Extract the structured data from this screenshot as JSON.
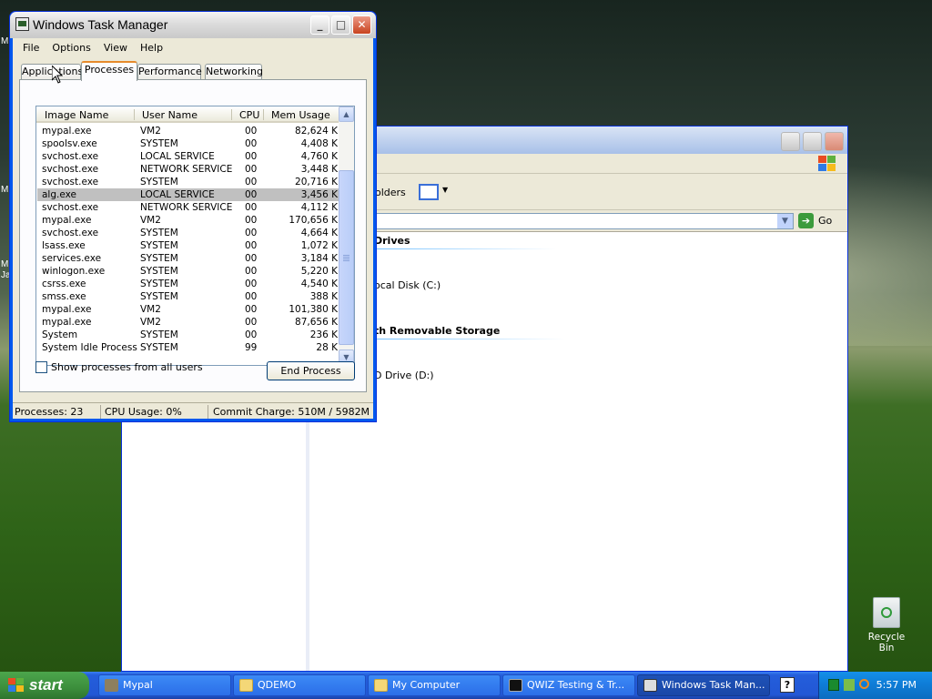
{
  "desktop": {
    "edge_letters": [
      "M",
      "M",
      "M",
      "Ja"
    ],
    "recycle_bin_label": "Recycle Bin"
  },
  "explorer": {
    "toolbar_folders": "olders",
    "go_label": "Go",
    "sections": [
      {
        "title": "Drives",
        "items": [
          "ocal Disk (C:)"
        ]
      },
      {
        "title": "th Removable Storage",
        "items": [
          "D Drive (D:)"
        ]
      }
    ]
  },
  "taskmgr": {
    "title": "Windows Task Manager",
    "menu": [
      "File",
      "Options",
      "View",
      "Help"
    ],
    "tabs": [
      "Applications",
      "Processes",
      "Performance",
      "Networking"
    ],
    "active_tab": "Processes",
    "columns": [
      "Image Name",
      "User Name",
      "CPU",
      "Mem Usage"
    ],
    "rows": [
      {
        "image": "mypal.exe",
        "user": "VM2",
        "cpu": "00",
        "mem": "82,624 K"
      },
      {
        "image": "spoolsv.exe",
        "user": "SYSTEM",
        "cpu": "00",
        "mem": "4,408 K"
      },
      {
        "image": "svchost.exe",
        "user": "LOCAL SERVICE",
        "cpu": "00",
        "mem": "4,760 K"
      },
      {
        "image": "svchost.exe",
        "user": "NETWORK SERVICE",
        "cpu": "00",
        "mem": "3,448 K"
      },
      {
        "image": "svchost.exe",
        "user": "SYSTEM",
        "cpu": "00",
        "mem": "20,716 K"
      },
      {
        "image": "alg.exe",
        "user": "LOCAL SERVICE",
        "cpu": "00",
        "mem": "3,456 K",
        "selected": true
      },
      {
        "image": "svchost.exe",
        "user": "NETWORK SERVICE",
        "cpu": "00",
        "mem": "4,112 K"
      },
      {
        "image": "mypal.exe",
        "user": "VM2",
        "cpu": "00",
        "mem": "170,656 K"
      },
      {
        "image": "svchost.exe",
        "user": "SYSTEM",
        "cpu": "00",
        "mem": "4,664 K"
      },
      {
        "image": "lsass.exe",
        "user": "SYSTEM",
        "cpu": "00",
        "mem": "1,072 K"
      },
      {
        "image": "services.exe",
        "user": "SYSTEM",
        "cpu": "00",
        "mem": "3,184 K"
      },
      {
        "image": "winlogon.exe",
        "user": "SYSTEM",
        "cpu": "00",
        "mem": "5,220 K"
      },
      {
        "image": "csrss.exe",
        "user": "SYSTEM",
        "cpu": "00",
        "mem": "4,540 K"
      },
      {
        "image": "smss.exe",
        "user": "SYSTEM",
        "cpu": "00",
        "mem": "388 K"
      },
      {
        "image": "mypal.exe",
        "user": "VM2",
        "cpu": "00",
        "mem": "101,380 K"
      },
      {
        "image": "mypal.exe",
        "user": "VM2",
        "cpu": "00",
        "mem": "87,656 K"
      },
      {
        "image": "System",
        "user": "SYSTEM",
        "cpu": "00",
        "mem": "236 K"
      },
      {
        "image": "System Idle Process",
        "user": "SYSTEM",
        "cpu": "99",
        "mem": "28 K"
      }
    ],
    "show_all_label": "Show processes from all users",
    "end_process_label": "End Process",
    "status": {
      "processes": "Processes: 23",
      "cpu": "CPU Usage: 0%",
      "commit": "Commit Charge: 510M / 5982M"
    }
  },
  "taskbar": {
    "start_label": "start",
    "buttons": [
      {
        "label": "Mypal",
        "icon": "mypal-icon"
      },
      {
        "label": "QDEMO",
        "icon": "folder-icon"
      },
      {
        "label": "My Computer",
        "icon": "folder-icon"
      },
      {
        "label": "QWIZ Testing & Tr...",
        "icon": "console-icon"
      },
      {
        "label": "Windows Task Man...",
        "icon": "taskmgr-icon",
        "active": true
      }
    ],
    "clock": "5:57 PM"
  },
  "colors": {
    "xp_blue": "#0831d9",
    "taskbar": "#245edb",
    "start_green": "#3c8e3c",
    "tab_highlight": "#e68b2c"
  }
}
